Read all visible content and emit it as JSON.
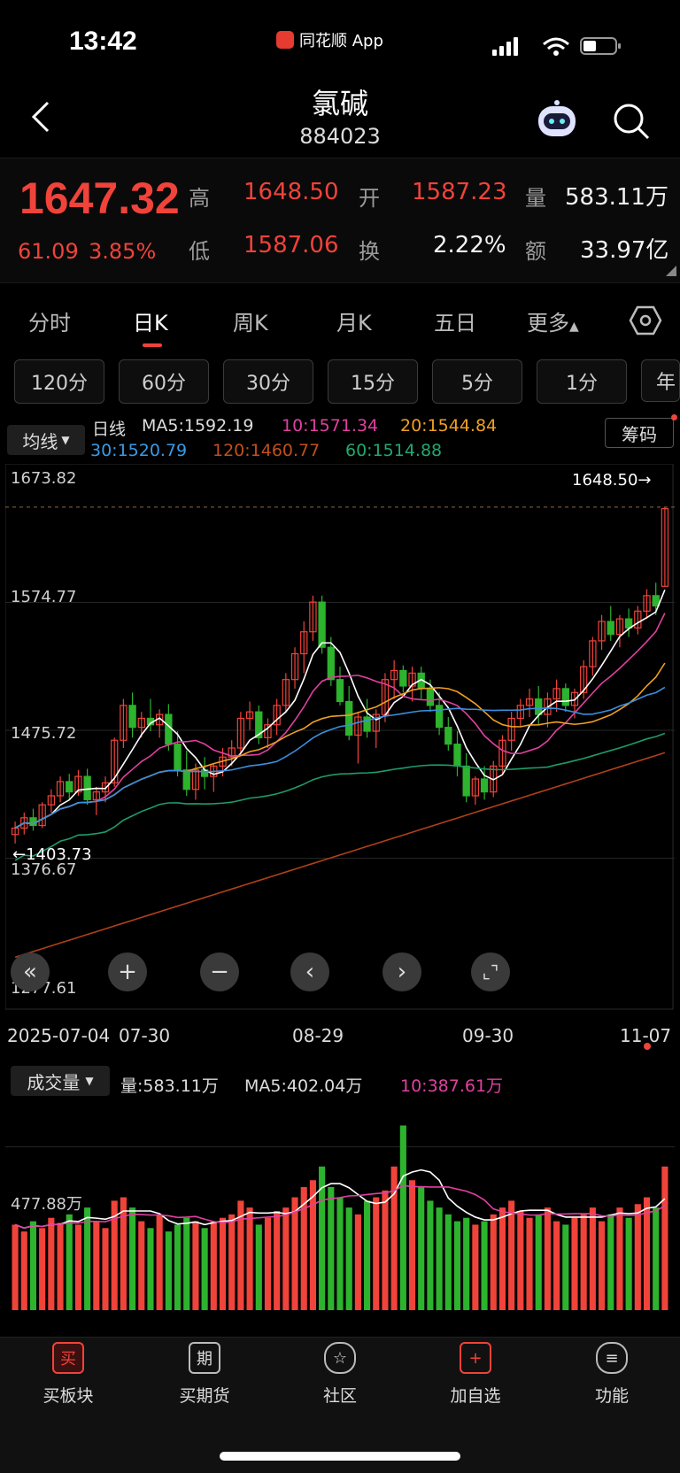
{
  "status_bar": {
    "time": "13:42",
    "app_label": "同花顺 App"
  },
  "header": {
    "title": "氯碱",
    "code": "884023"
  },
  "quote": {
    "price": "1647.32",
    "change": "61.09",
    "change_pct": "3.85%",
    "high_label": "高",
    "high": "1648.50",
    "open_label": "开",
    "open": "1587.23",
    "volume_label": "量",
    "volume": "583.11万",
    "low_label": "低",
    "low": "1587.06",
    "turnover_label": "换",
    "turnover": "2.22%",
    "amount_label": "额",
    "amount": "33.97亿"
  },
  "tabs": [
    "分时",
    "日K",
    "周K",
    "月K",
    "五日",
    "更多"
  ],
  "active_tab": "日K",
  "intervals": [
    "120分",
    "60分",
    "30分",
    "15分",
    "5分",
    "1分",
    "年"
  ],
  "ma_panel": {
    "button": "均线",
    "period": "日线",
    "ma5": "MA5:1592.19",
    "ma10": "10:1571.34",
    "ma20": "20:1544.84",
    "ma30": "30:1520.79",
    "ma120": "120:1460.77",
    "ma60": "60:1514.88",
    "chip_button": "筹码"
  },
  "price_axis": {
    "labels": [
      "1673.82",
      "1574.77",
      "1475.72",
      "1376.67",
      "1277.61"
    ],
    "high_marker": "1648.50→",
    "low_marker": "←1403.73"
  },
  "date_axis": [
    "2025-07-04",
    "07-30",
    "08-29",
    "09-30",
    "11-07"
  ],
  "volume_panel": {
    "button": "成交量",
    "vol": "量:583.11万",
    "ma5": "MA5:402.04万",
    "ma10": "10:387.61万",
    "axis_label": "477.88万"
  },
  "bottom_nav": [
    "买板块",
    "买期货",
    "社区",
    "加自选",
    "功能"
  ],
  "colors": {
    "up": "#f0433a",
    "down": "#2db32d",
    "ma5": "#ffffff",
    "ma10": "#e040a0",
    "ma20": "#f0a020",
    "ma30": "#3a8fe0",
    "ma60": "#1f9c6a",
    "ma120": "#b0401a"
  },
  "chart_data": {
    "type": "candlestick",
    "ylim": [
      1277.61,
      1673.82
    ],
    "candles": [
      [
        1395,
        1405,
        1388,
        1400
      ],
      [
        1400,
        1412,
        1395,
        1408
      ],
      [
        1408,
        1415,
        1398,
        1402
      ],
      [
        1402,
        1420,
        1400,
        1418
      ],
      [
        1418,
        1430,
        1412,
        1425
      ],
      [
        1425,
        1440,
        1420,
        1436
      ],
      [
        1436,
        1442,
        1422,
        1428
      ],
      [
        1428,
        1445,
        1425,
        1440
      ],
      [
        1440,
        1446,
        1418,
        1422
      ],
      [
        1422,
        1432,
        1410,
        1428
      ],
      [
        1428,
        1440,
        1420,
        1435
      ],
      [
        1435,
        1470,
        1432,
        1468
      ],
      [
        1468,
        1500,
        1462,
        1495
      ],
      [
        1495,
        1505,
        1470,
        1478
      ],
      [
        1478,
        1490,
        1470,
        1485
      ],
      [
        1485,
        1500,
        1475,
        1480
      ],
      [
        1480,
        1492,
        1470,
        1488
      ],
      [
        1488,
        1496,
        1460,
        1465
      ],
      [
        1465,
        1475,
        1440,
        1445
      ],
      [
        1445,
        1460,
        1425,
        1430
      ],
      [
        1430,
        1450,
        1422,
        1445
      ],
      [
        1445,
        1455,
        1430,
        1440
      ],
      [
        1440,
        1450,
        1428,
        1448
      ],
      [
        1448,
        1462,
        1440,
        1455
      ],
      [
        1455,
        1468,
        1448,
        1462
      ],
      [
        1462,
        1490,
        1458,
        1485
      ],
      [
        1485,
        1498,
        1476,
        1490
      ],
      [
        1490,
        1495,
        1465,
        1470
      ],
      [
        1470,
        1485,
        1462,
        1480
      ],
      [
        1480,
        1500,
        1472,
        1495
      ],
      [
        1495,
        1520,
        1490,
        1515
      ],
      [
        1515,
        1540,
        1508,
        1535
      ],
      [
        1535,
        1560,
        1520,
        1552
      ],
      [
        1552,
        1580,
        1545,
        1575
      ],
      [
        1575,
        1580,
        1535,
        1540
      ],
      [
        1540,
        1548,
        1510,
        1515
      ],
      [
        1515,
        1525,
        1495,
        1498
      ],
      [
        1498,
        1510,
        1468,
        1472
      ],
      [
        1472,
        1490,
        1450,
        1486
      ],
      [
        1486,
        1500,
        1470,
        1475
      ],
      [
        1475,
        1492,
        1462,
        1488
      ],
      [
        1488,
        1520,
        1482,
        1515
      ],
      [
        1515,
        1530,
        1500,
        1522
      ],
      [
        1522,
        1526,
        1505,
        1510
      ],
      [
        1510,
        1525,
        1498,
        1520
      ],
      [
        1520,
        1525,
        1500,
        1508
      ],
      [
        1508,
        1515,
        1490,
        1495
      ],
      [
        1495,
        1505,
        1472,
        1478
      ],
      [
        1478,
        1486,
        1460,
        1465
      ],
      [
        1465,
        1475,
        1440,
        1448
      ],
      [
        1448,
        1458,
        1420,
        1425
      ],
      [
        1425,
        1440,
        1418,
        1438
      ],
      [
        1438,
        1448,
        1422,
        1428
      ],
      [
        1428,
        1452,
        1424,
        1448
      ],
      [
        1448,
        1472,
        1442,
        1468
      ],
      [
        1468,
        1490,
        1460,
        1485
      ],
      [
        1485,
        1500,
        1478,
        1495
      ],
      [
        1495,
        1508,
        1486,
        1500
      ],
      [
        1500,
        1510,
        1480,
        1488
      ],
      [
        1488,
        1505,
        1478,
        1500
      ],
      [
        1500,
        1515,
        1490,
        1508
      ],
      [
        1508,
        1512,
        1490,
        1495
      ],
      [
        1495,
        1508,
        1485,
        1505
      ],
      [
        1505,
        1530,
        1500,
        1525
      ],
      [
        1525,
        1548,
        1518,
        1545
      ],
      [
        1545,
        1565,
        1538,
        1560
      ],
      [
        1560,
        1572,
        1545,
        1550
      ],
      [
        1550,
        1565,
        1540,
        1562
      ],
      [
        1562,
        1570,
        1548,
        1555
      ],
      [
        1555,
        1572,
        1550,
        1568
      ],
      [
        1568,
        1585,
        1562,
        1580
      ],
      [
        1580,
        1590,
        1565,
        1572
      ],
      [
        1587.23,
        1648.5,
        1587.06,
        1647.32
      ]
    ],
    "volume_unit": "万",
    "volumes": [
      250,
      230,
      260,
      240,
      270,
      255,
      280,
      250,
      300,
      260,
      240,
      320,
      330,
      300,
      260,
      240,
      280,
      230,
      250,
      270,
      260,
      240,
      260,
      270,
      280,
      320,
      300,
      250,
      270,
      290,
      300,
      330,
      360,
      380,
      420,
      360,
      330,
      300,
      280,
      320,
      330,
      350,
      420,
      540,
      380,
      360,
      320,
      300,
      280,
      260,
      270,
      250,
      260,
      280,
      300,
      320,
      290,
      270,
      280,
      300,
      260,
      250,
      270,
      280,
      300,
      260,
      280,
      300,
      270,
      310,
      330,
      300,
      420
    ]
  }
}
